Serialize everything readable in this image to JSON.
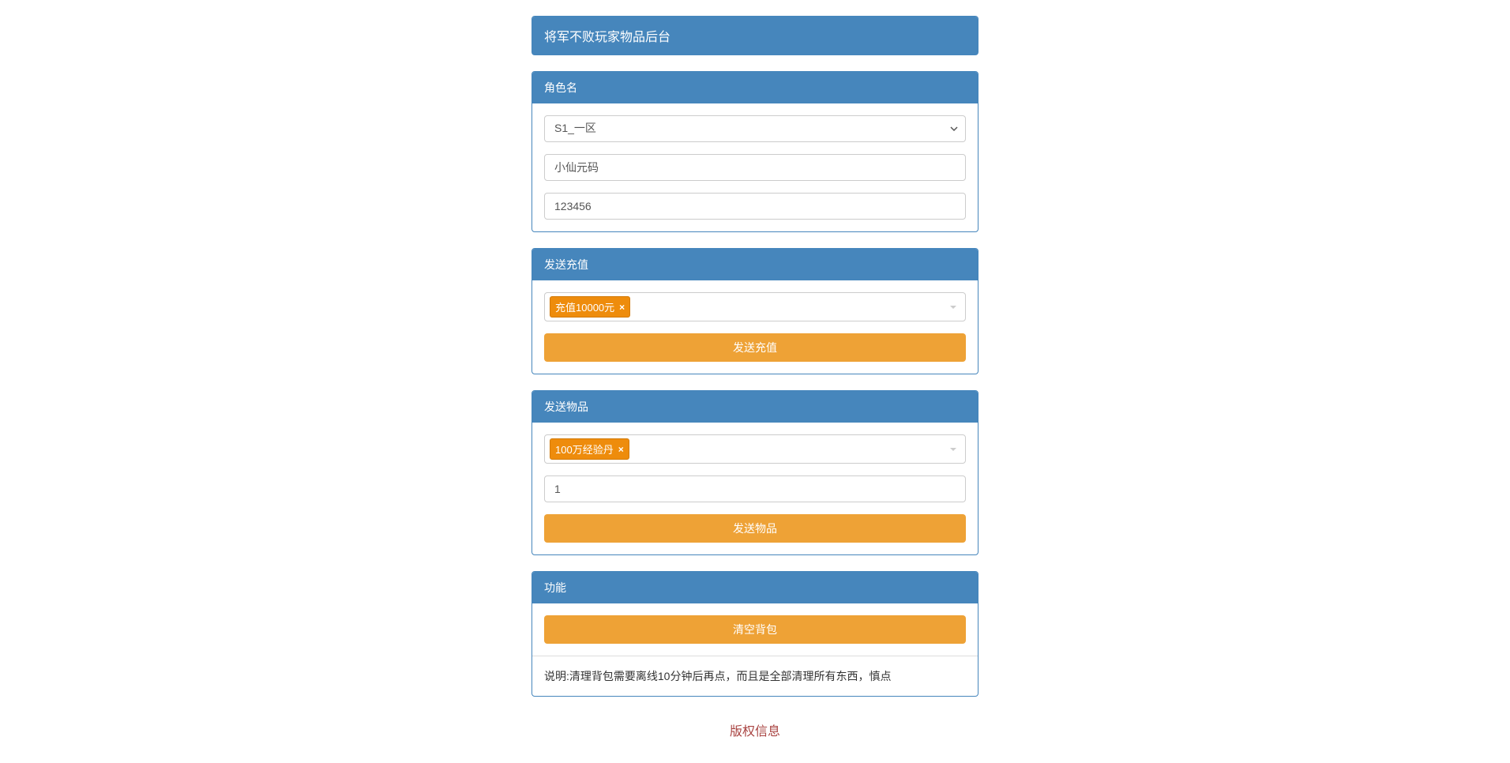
{
  "header": {
    "title": "将军不败玩家物品后台"
  },
  "panel_role": {
    "title": "角色名",
    "server_selected": "S1_一区",
    "username_value": "小仙元码",
    "password_value": "123456"
  },
  "panel_recharge": {
    "title": "发送充值",
    "selected_tag": "充值10000元",
    "send_button": "发送充值"
  },
  "panel_items": {
    "title": "发送物品",
    "selected_tag": "100万经验丹",
    "quantity_value": "1",
    "send_button": "发送物品"
  },
  "panel_actions": {
    "title": "功能",
    "clear_bag_button": "清空背包",
    "help_text": "说明:清理背包需要离线10分钟后再点，而且是全部清理所有东西，慎点"
  },
  "footer": {
    "copyright": "版权信息"
  }
}
